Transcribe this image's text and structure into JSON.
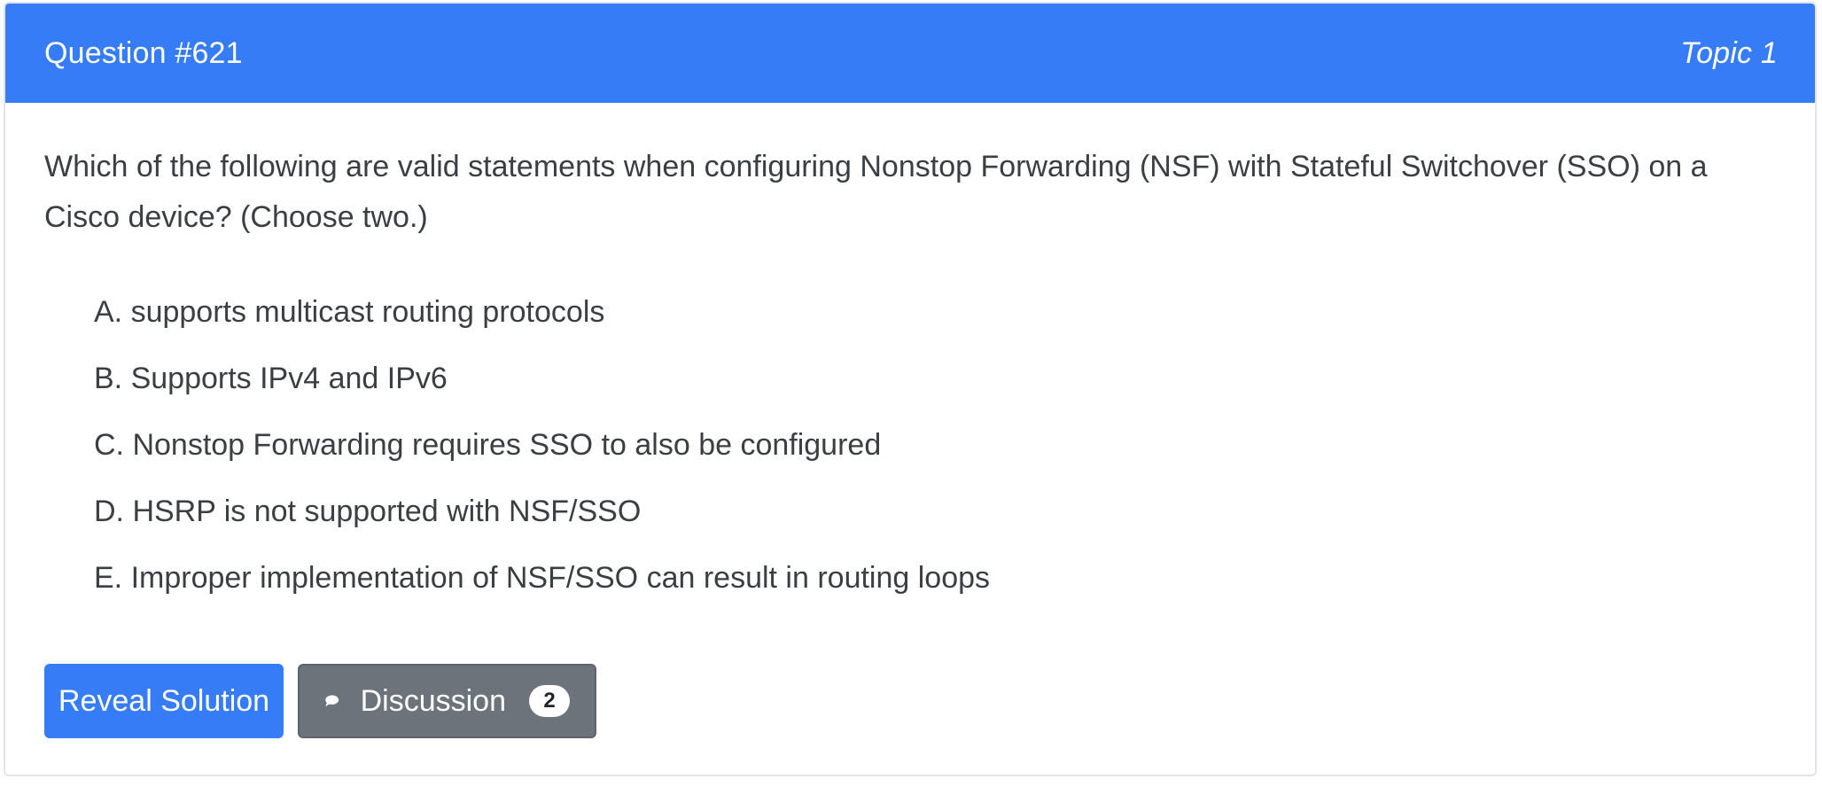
{
  "header": {
    "title": "Question #621",
    "topic": "Topic 1"
  },
  "question": {
    "text": "Which of the following are valid statements when configuring Nonstop Forwarding (NSF) with Stateful Switchover (SSO) on a Cisco device? (Choose two.)",
    "choices": [
      {
        "label": "A. supports multicast routing protocols"
      },
      {
        "label": "B. Supports IPv4 and IPv6"
      },
      {
        "label": "C. Nonstop Forwarding requires SSO to also be configured"
      },
      {
        "label": "D. HSRP is not supported with NSF/SSO"
      },
      {
        "label": "E. Improper implementation of NSF/SSO can result in routing loops"
      }
    ]
  },
  "actions": {
    "reveal_label": "Reveal Solution",
    "discussion_label": "Discussion",
    "discussion_count": "2",
    "discussion_icon": "chat-bubble-icon"
  },
  "colors": {
    "header_bg": "#367cf7",
    "reveal_bg": "#367cf7",
    "discussion_bg": "#6c737b"
  }
}
